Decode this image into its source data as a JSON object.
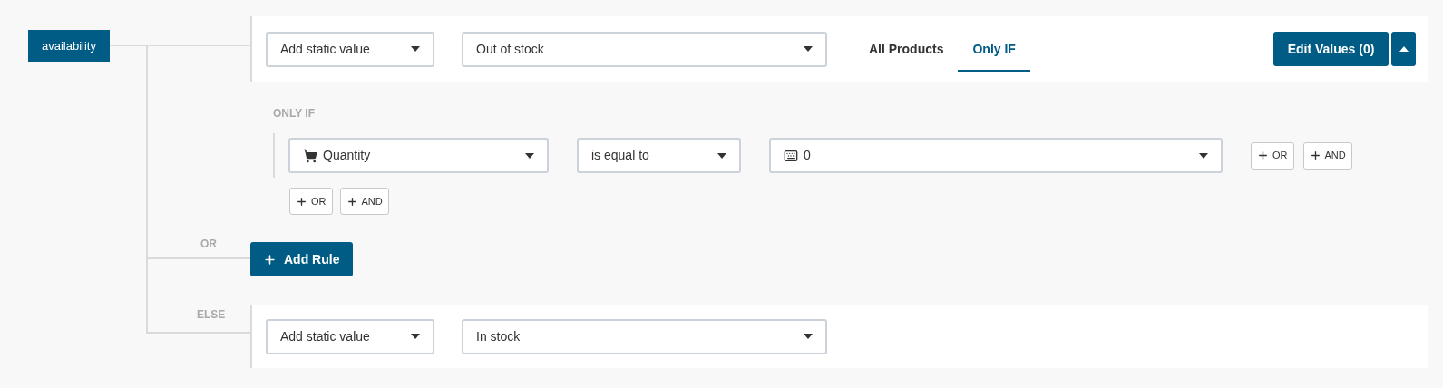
{
  "field_tag": "availability",
  "rule": {
    "source": "Add static value",
    "value": "Out of stock",
    "tabs": [
      {
        "label": "All Products",
        "selected": false
      },
      {
        "label": "Only IF",
        "selected": true
      }
    ],
    "edit_button": "Edit Values (0)"
  },
  "condition_section": {
    "label": "ONLY IF",
    "conditions": [
      {
        "field": "Quantity",
        "operator": "is equal to",
        "value": "0",
        "buttons": [
          "OR",
          "AND"
        ]
      }
    ],
    "buttons": [
      "OR",
      "AND"
    ]
  },
  "or_label": "OR",
  "add_rule_button": "Add Rule",
  "else": {
    "label": "ELSE",
    "source": "Add static value",
    "value": "In stock"
  }
}
